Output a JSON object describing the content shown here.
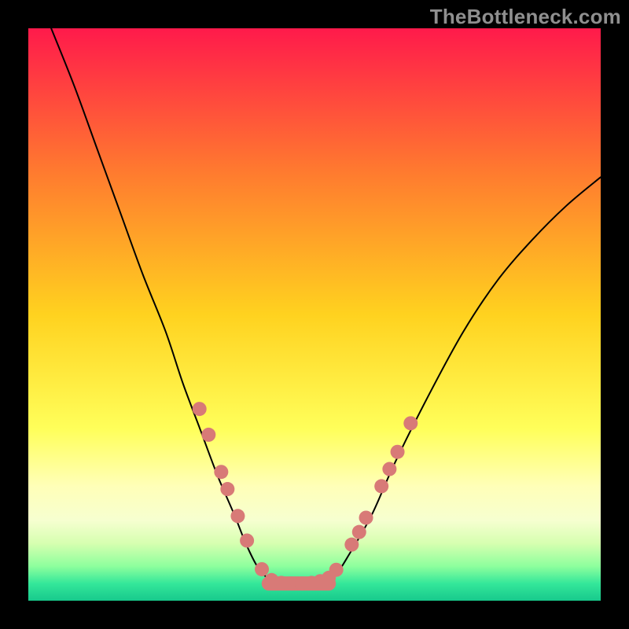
{
  "watermark": "TheBottleneck.com",
  "chart_data": {
    "type": "line",
    "title": "",
    "xlabel": "",
    "ylabel": "",
    "xlim": [
      0,
      100
    ],
    "ylim": [
      0,
      100
    ],
    "legend": false,
    "grid": false,
    "background": {
      "type": "vertical-gradient",
      "stops": [
        {
          "pos": 0.0,
          "color": "#ff1a4b"
        },
        {
          "pos": 0.25,
          "color": "#ff7a2f"
        },
        {
          "pos": 0.5,
          "color": "#ffd21f"
        },
        {
          "pos": 0.7,
          "color": "#ffff5a"
        },
        {
          "pos": 0.8,
          "color": "#ffffb8"
        },
        {
          "pos": 0.86,
          "color": "#f6ffd0"
        },
        {
          "pos": 0.9,
          "color": "#d6ffb0"
        },
        {
          "pos": 0.94,
          "color": "#8dff9d"
        },
        {
          "pos": 0.97,
          "color": "#34e79a"
        },
        {
          "pos": 1.0,
          "color": "#17c98c"
        }
      ]
    },
    "series": [
      {
        "name": "bottleneck-curve",
        "stroke": "#000000",
        "strokeWidth": 2,
        "points": [
          [
            4,
            100
          ],
          [
            8,
            90
          ],
          [
            12,
            79
          ],
          [
            16,
            68
          ],
          [
            20,
            57
          ],
          [
            24,
            47
          ],
          [
            27,
            38
          ],
          [
            30,
            30
          ],
          [
            33,
            22
          ],
          [
            36,
            15
          ],
          [
            38,
            10
          ],
          [
            40,
            6
          ],
          [
            42,
            3.8
          ],
          [
            44,
            3.2
          ],
          [
            46,
            3.0
          ],
          [
            48,
            3.0
          ],
          [
            50,
            3.2
          ],
          [
            52,
            3.8
          ],
          [
            54,
            5
          ],
          [
            56,
            8
          ],
          [
            60,
            15
          ],
          [
            64,
            24
          ],
          [
            70,
            36
          ],
          [
            76,
            47
          ],
          [
            82,
            56
          ],
          [
            88,
            63
          ],
          [
            94,
            69
          ],
          [
            100,
            74
          ]
        ]
      }
    ],
    "scatter_overlay": {
      "name": "sample-dots",
      "fill": "#d87a77",
      "radius": 9,
      "points": [
        [
          29.9,
          33.5
        ],
        [
          31.5,
          29.0
        ],
        [
          33.7,
          22.5
        ],
        [
          34.8,
          19.5
        ],
        [
          36.6,
          14.8
        ],
        [
          38.2,
          10.5
        ],
        [
          40.8,
          5.5
        ],
        [
          42.5,
          3.6
        ],
        [
          44.2,
          3.1
        ],
        [
          46.0,
          3.0
        ],
        [
          47.8,
          3.0
        ],
        [
          49.5,
          3.1
        ],
        [
          51.0,
          3.4
        ],
        [
          52.5,
          4.0
        ],
        [
          53.8,
          5.4
        ],
        [
          56.5,
          9.8
        ],
        [
          57.8,
          12.0
        ],
        [
          59.0,
          14.5
        ],
        [
          61.7,
          20.0
        ],
        [
          63.1,
          23.0
        ],
        [
          64.5,
          26.0
        ],
        [
          66.8,
          31.0
        ]
      ]
    },
    "flat_segment": {
      "name": "optimal-band",
      "stroke": "#d87a77",
      "strokeWidth": 18,
      "y": 3.0,
      "x_range": [
        42.0,
        52.5
      ]
    }
  }
}
